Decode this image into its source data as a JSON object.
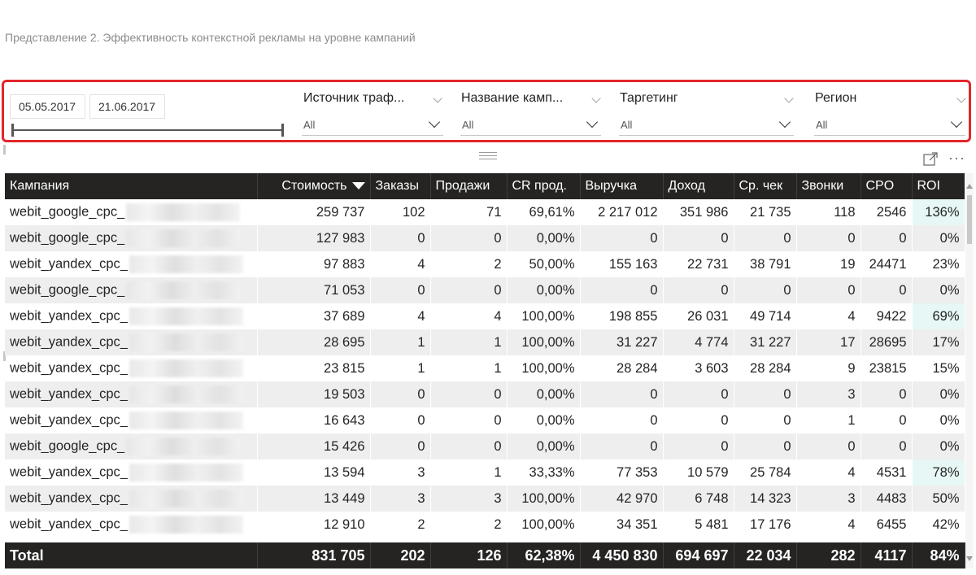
{
  "page_title": "Представление 2. Эффективность контекстной рекламы на уровне кампаний",
  "date_filter": {
    "start": "05.05.2017",
    "end": "21.06.2017"
  },
  "slicers": [
    {
      "title": "Источник траф...",
      "value": "All"
    },
    {
      "title": "Название камп...",
      "value": "All"
    },
    {
      "title": "Таргетинг",
      "value": "All"
    },
    {
      "title": "Регион",
      "value": "All"
    }
  ],
  "table": {
    "columns": [
      "Кампания",
      "Стоимость",
      "Заказы",
      "Продажи",
      "CR прод.",
      "Выручка",
      "Доход",
      "Ср. чек",
      "Звонки",
      "CPO",
      "ROI"
    ],
    "sort_column": "Стоимость",
    "rows": [
      [
        "webit_google_cpc_",
        "259 737",
        "102",
        "71",
        "69,61%",
        "2 217 012",
        "351 986",
        "21 735",
        "118",
        "2546",
        "136%"
      ],
      [
        "webit_google_cpc_",
        "127 983",
        "0",
        "0",
        "0,00%",
        "0",
        "0",
        "0",
        "0",
        "0",
        "0%"
      ],
      [
        "webit_yandex_cpc_",
        "97 883",
        "4",
        "2",
        "50,00%",
        "155 163",
        "22 731",
        "38 791",
        "19",
        "24471",
        "23%"
      ],
      [
        "webit_google_cpc_",
        "71 053",
        "0",
        "0",
        "0,00%",
        "0",
        "0",
        "0",
        "0",
        "0",
        "0%"
      ],
      [
        "webit_yandex_cpc_",
        "37 689",
        "4",
        "4",
        "100,00%",
        "198 855",
        "26 031",
        "49 714",
        "4",
        "9422",
        "69%"
      ],
      [
        "webit_yandex_cpc_",
        "28 695",
        "1",
        "1",
        "100,00%",
        "31 227",
        "4 774",
        "31 227",
        "17",
        "28695",
        "17%"
      ],
      [
        "webit_yandex_cpc_",
        "23 815",
        "1",
        "1",
        "100,00%",
        "28 284",
        "3 603",
        "28 284",
        "9",
        "23815",
        "15%"
      ],
      [
        "webit_yandex_cpc_",
        "19 503",
        "0",
        "0",
        "0,00%",
        "0",
        "0",
        "0",
        "3",
        "0",
        "0%"
      ],
      [
        "webit_yandex_cpc_",
        "16 643",
        "0",
        "0",
        "0,00%",
        "0",
        "0",
        "0",
        "1",
        "0",
        "0%"
      ],
      [
        "webit_google_cpc_",
        "15 426",
        "0",
        "0",
        "0,00%",
        "0",
        "0",
        "0",
        "0",
        "0",
        "0%"
      ],
      [
        "webit_yandex_cpc_",
        "13 594",
        "3",
        "1",
        "33,33%",
        "77 353",
        "10 579",
        "25 784",
        "4",
        "4531",
        "78%"
      ],
      [
        "webit_yandex_cpc_",
        "13 449",
        "3",
        "3",
        "100,00%",
        "42 970",
        "6 748",
        "14 323",
        "3",
        "4483",
        "50%"
      ],
      [
        "webit_yandex_cpc_",
        "12 910",
        "2",
        "2",
        "100,00%",
        "34 351",
        "5 481",
        "17 176",
        "4",
        "6455",
        "42%"
      ]
    ],
    "roi_highlight_color": "#e6f7f5",
    "total": [
      "Total",
      "831 705",
      "202",
      "126",
      "62,38%",
      "4 450 830",
      "694 697",
      "22 034",
      "282",
      "4117",
      "84%"
    ]
  },
  "colors": {
    "filter_border": "#e3262b",
    "header_bg": "#252423",
    "row_alt_bg": "#eeeeee"
  },
  "icons": [
    "focus-mode-icon",
    "more-options-icon",
    "drag-handle-icon",
    "chevron-down-icon"
  ]
}
